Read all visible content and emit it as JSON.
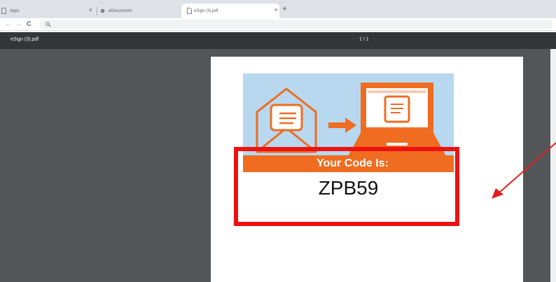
{
  "browser": {
    "tabs": [
      {
        "label": "Apps",
        "icon": "page-icon"
      },
      {
        "label": "eDocuments",
        "icon": "gear-icon"
      },
      {
        "label": "eSign (3).pdf",
        "icon": "page-icon",
        "active": true
      }
    ],
    "close_glyph": "×",
    "new_tab_glyph": "+",
    "nav": {
      "back": "←",
      "forward": "→",
      "reload": "C"
    }
  },
  "pdf_viewer": {
    "file_name": "eSign (3).pdf",
    "page_indicator": "1 / 1"
  },
  "document": {
    "banner_text": "Your Code Is:",
    "code": "ZPB59",
    "colors": {
      "banner": "#ef6c21",
      "art_background": "#b7d8ee",
      "highlight": "#ee1111"
    }
  }
}
